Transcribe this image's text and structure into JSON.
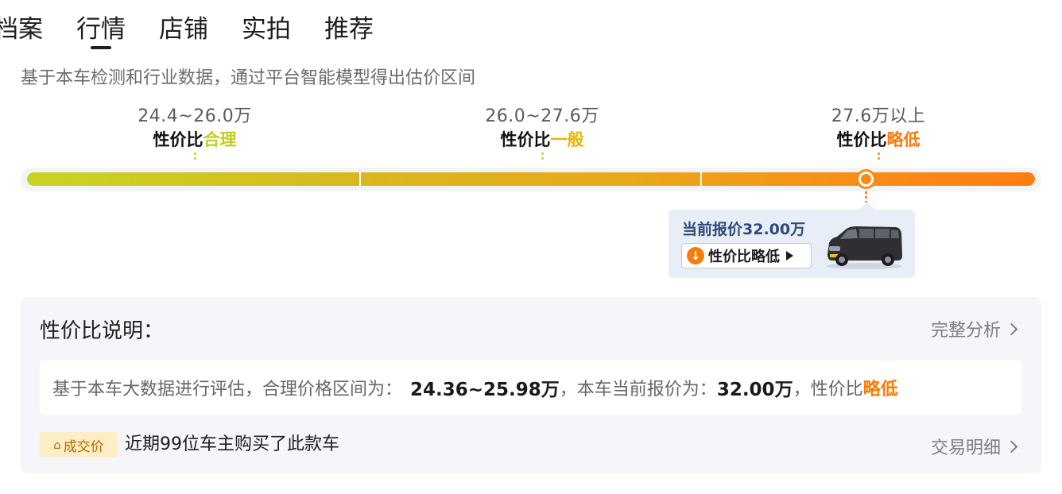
{
  "tabs": [
    {
      "label": "档案",
      "active": false
    },
    {
      "label": "行情",
      "active": true
    },
    {
      "label": "店铺",
      "active": false
    },
    {
      "label": "实拍",
      "active": false
    },
    {
      "label": "推荐",
      "active": false
    }
  ],
  "subtitle": "基于本车检测和行业数据，通过平台智能模型得出估价区间",
  "ranges": [
    {
      "price": "24.4~26.0万",
      "prefix": "性价比",
      "level": "合理",
      "color": "#c4cd1e"
    },
    {
      "price": "26.0~27.6万",
      "prefix": "性价比",
      "level": "一般",
      "color": "#e6b60a"
    },
    {
      "price": "27.6万以上",
      "prefix": "性价比",
      "level": "略低",
      "color": "#f57c0e"
    }
  ],
  "current": {
    "label": "当前报价32.00万",
    "badge_text": "性价比略低",
    "icon": "arrow-down-circle-icon",
    "image": "van-icon"
  },
  "panel": {
    "title": "性价比说明：",
    "analysis_link": "完整分析",
    "explain": {
      "part1": "基于本车大数据进行评估，合理价格区间为：",
      "range": "24.36~25.98万",
      "part2": "，本车当前报价为：",
      "price": "32.00万",
      "part3": "，性价比",
      "level": "略低"
    },
    "deal_badge": "成交价",
    "deal_text": "近期99位车主购买了此款车",
    "detail_link": "交易明细"
  },
  "colors": {
    "bar_start": "#c8d422",
    "bar_end": "#ff7d12",
    "accent": "#ff7a00",
    "card_bg": "#e8eef7"
  }
}
